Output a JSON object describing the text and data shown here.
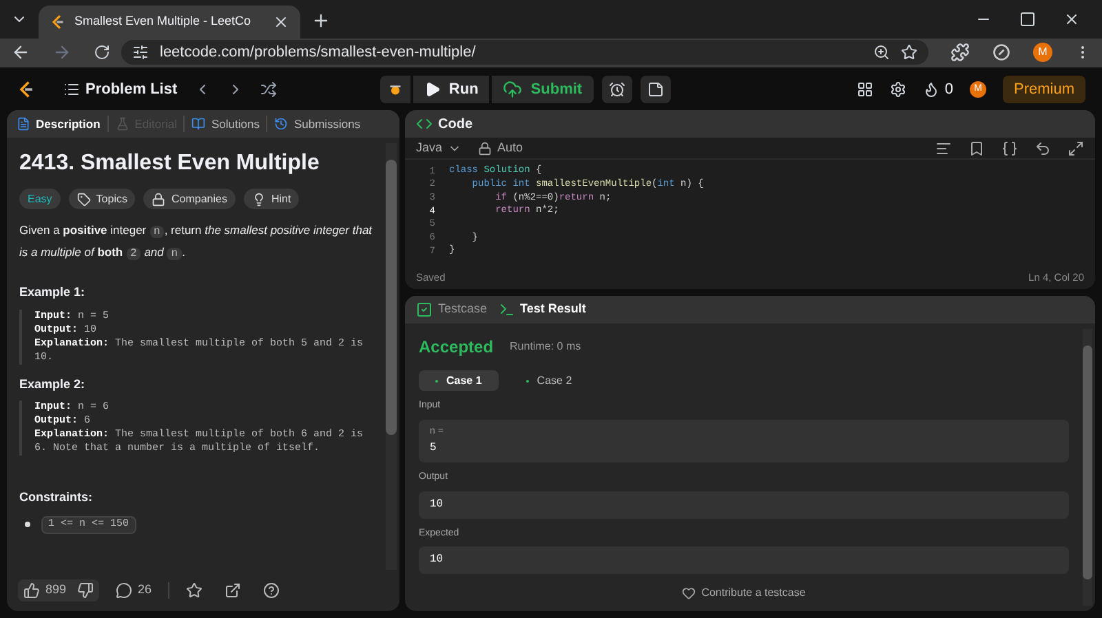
{
  "browser": {
    "tab_title": "Smallest Even Multiple - LeetCo",
    "url": "leetcode.com/problems/smallest-even-multiple/",
    "avatar": "M"
  },
  "topbar": {
    "problem_list": "Problem List",
    "run": "Run",
    "submit": "Submit",
    "streak": "0",
    "avatar": "M",
    "premium": "Premium"
  },
  "description_panel": {
    "tabs": [
      {
        "label": "Description",
        "selected": true,
        "disabled": false
      },
      {
        "label": "Editorial",
        "selected": false,
        "disabled": true
      },
      {
        "label": "Solutions",
        "selected": false,
        "disabled": false
      },
      {
        "label": "Submissions",
        "selected": false,
        "disabled": false
      }
    ],
    "title": "2413. Smallest Even Multiple",
    "tags": [
      {
        "kind": "difficulty",
        "label": "Easy"
      },
      {
        "kind": "topics",
        "label": "Topics"
      },
      {
        "kind": "companies",
        "label": "Companies"
      },
      {
        "kind": "hint",
        "label": "Hint"
      }
    ],
    "statement": [
      {
        "kind": "text",
        "text": "Given a **positive** integer "
      },
      {
        "kind": "code",
        "text": "n"
      },
      {
        "kind": "text",
        "text": ", return *the smallest positive integer that is a multiple of* **both** "
      },
      {
        "kind": "code",
        "text": "2"
      },
      {
        "kind": "text",
        "text": " *and* "
      },
      {
        "kind": "code",
        "text": "n"
      },
      {
        "kind": "text",
        "text": "."
      }
    ],
    "examples": [
      {
        "title": "Example 1:",
        "lines": [
          {
            "label": "Input:",
            "value": "n = 5"
          },
          {
            "label": "Output:",
            "value": "10"
          },
          {
            "label": "Explanation:",
            "value": "The smallest multiple of both 5 and 2 is 10."
          }
        ]
      },
      {
        "title": "Example 2:",
        "lines": [
          {
            "label": "Input:",
            "value": "n = 6"
          },
          {
            "label": "Output:",
            "value": "6"
          },
          {
            "label": "Explanation:",
            "value": "The smallest multiple of both 6 and 2 is 6. Note that a number is a multiple of itself."
          }
        ]
      }
    ],
    "constraints_title": "Constraints:",
    "constraints": [
      "1 <= n <= 150"
    ],
    "footer": {
      "likes": "899",
      "comments": "26"
    }
  },
  "code_panel": {
    "title": "Code",
    "language": "Java",
    "mode": "Auto",
    "lines": [
      {
        "number": "1",
        "current": false,
        "tokens": [
          {
            "kind": "keyword",
            "text": "class "
          },
          {
            "kind": "type",
            "text": "Solution"
          },
          {
            "kind": "plain",
            "text": " {"
          }
        ]
      },
      {
        "number": "2",
        "current": false,
        "tokens": [
          {
            "kind": "keyword",
            "text": "    public int "
          },
          {
            "kind": "method",
            "text": "smallestEvenMultiple"
          },
          {
            "kind": "plain",
            "text": "("
          },
          {
            "kind": "keyword",
            "text": "int"
          },
          {
            "kind": "plain",
            "text": " n) {"
          }
        ]
      },
      {
        "number": "3",
        "current": false,
        "tokens": [
          {
            "kind": "control",
            "text": "        if"
          },
          {
            "kind": "plain",
            "text": " (n%2==0)"
          },
          {
            "kind": "control",
            "text": "return"
          },
          {
            "kind": "plain",
            "text": " n;"
          }
        ]
      },
      {
        "number": "4",
        "current": true,
        "tokens": [
          {
            "kind": "control",
            "text": "        return"
          },
          {
            "kind": "plain",
            "text": " n*2;"
          }
        ]
      },
      {
        "number": "5",
        "current": false
      },
      {
        "number": "6",
        "current": false,
        "tokens": [
          {
            "kind": "plain",
            "text": "    }"
          }
        ]
      },
      {
        "number": "7",
        "current": false,
        "tokens": [
          {
            "kind": "plain",
            "text": "}"
          }
        ]
      }
    ],
    "status": "Saved",
    "cursor": "Ln 4, Col 20"
  },
  "result_panel": {
    "tabs": [
      {
        "label": "Testcase",
        "selected": false
      },
      {
        "label": "Test Result",
        "selected": true
      }
    ],
    "verdict": "Accepted",
    "runtime": "Runtime: 0 ms",
    "cases": [
      {
        "label": "Case 1",
        "selected": true
      },
      {
        "label": "Case 2",
        "selected": false
      }
    ],
    "sections": [
      {
        "label": "Input",
        "name": "n =",
        "value": "5"
      },
      {
        "label": "Output",
        "value": "10"
      },
      {
        "label": "Expected",
        "value": "10"
      }
    ],
    "contribute": "Contribute a testcase"
  }
}
